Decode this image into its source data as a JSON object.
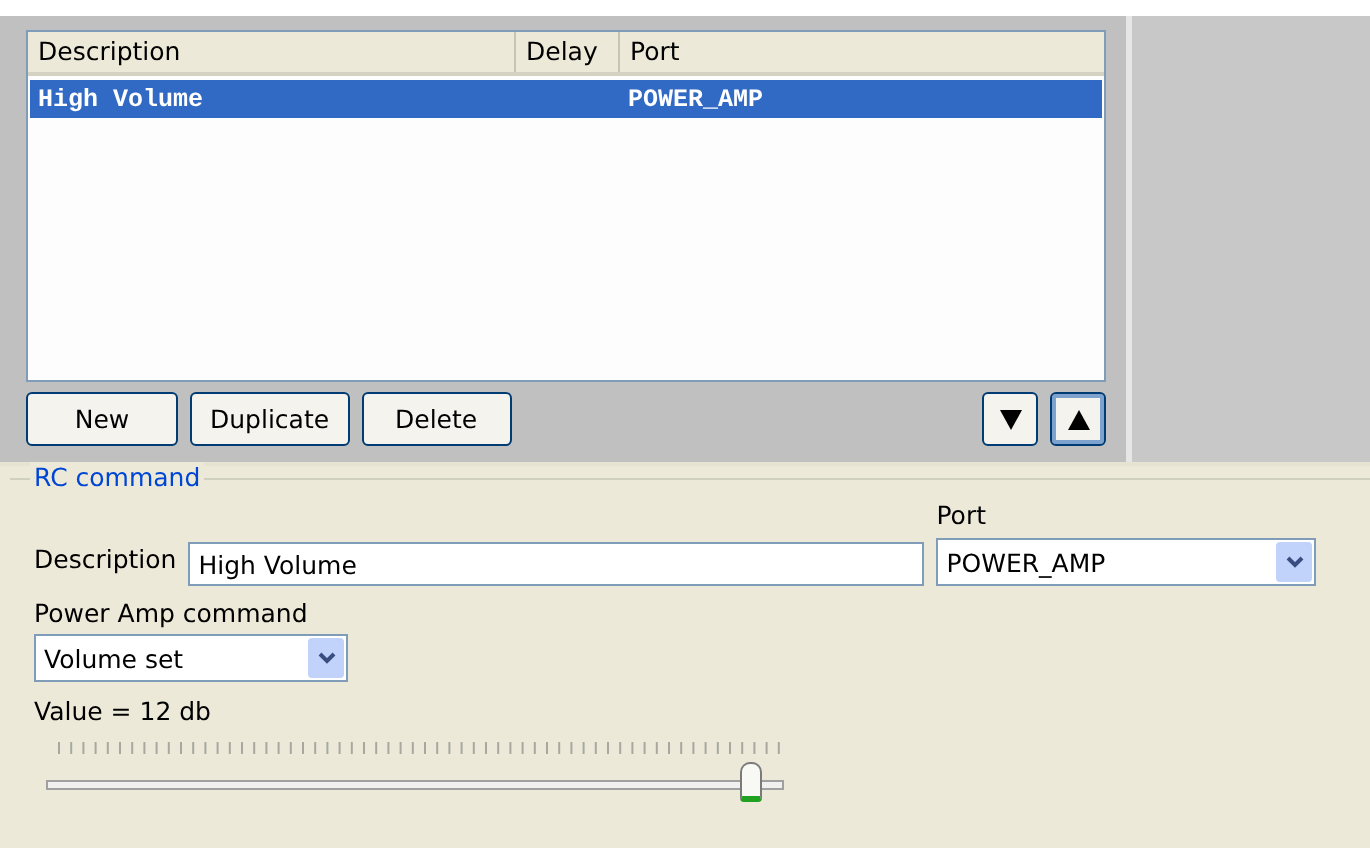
{
  "table": {
    "columns": [
      "Description",
      "Delay",
      "Port"
    ],
    "rows": [
      {
        "cells": [
          "High Volume",
          "",
          "POWER_AMP"
        ],
        "selected": true
      }
    ]
  },
  "list_buttons": [
    "New",
    "Duplicate",
    "Delete"
  ],
  "move_buttons": [
    {
      "kind": "down",
      "focused": false
    },
    {
      "kind": "up",
      "focused": true
    }
  ],
  "group": {
    "title": "RC command",
    "description_label": "Description",
    "description_value": "High Volume",
    "port_label": "Port",
    "port_value": "POWER_AMP",
    "command_label": "Power Amp command",
    "command_value": "Volume set",
    "value_text": "Value = 12 db",
    "level": 0.96
  }
}
